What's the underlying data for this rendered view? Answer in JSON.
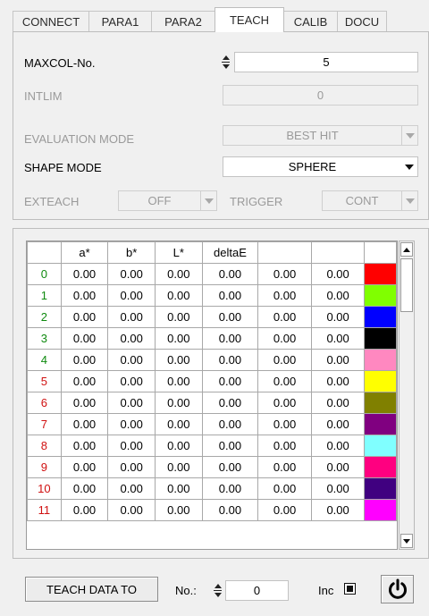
{
  "tabs": [
    "CONNECT",
    "PARA1",
    "PARA2",
    "TEACH",
    "CALIB",
    "DOCU"
  ],
  "active_tab": "TEACH",
  "settings": {
    "maxcol_label": "MAXCOL-No.",
    "maxcol_value": "5",
    "intlim_label": "INTLIM",
    "intlim_value": "0",
    "evaluation_label": "EVALUATION MODE",
    "evaluation_value": "BEST HIT",
    "shape_label": "SHAPE MODE",
    "shape_value": "SPHERE",
    "exteach_label": "EXTEACH",
    "exteach_value": "OFF",
    "trigger_label": "TRIGGER",
    "trigger_value": "CONT"
  },
  "table": {
    "headers": [
      "",
      "a*",
      "b*",
      "L*",
      "deltaE",
      "",
      "",
      ""
    ],
    "rows": [
      {
        "idx": "0",
        "idx_color": "#0f8a0f",
        "values": [
          "0.00",
          "0.00",
          "0.00",
          "0.00",
          "0.00",
          "0.00"
        ],
        "swatch": "#ff0000"
      },
      {
        "idx": "1",
        "idx_color": "#0f8a0f",
        "values": [
          "0.00",
          "0.00",
          "0.00",
          "0.00",
          "0.00",
          "0.00"
        ],
        "swatch": "#80ff00"
      },
      {
        "idx": "2",
        "idx_color": "#0f8a0f",
        "values": [
          "0.00",
          "0.00",
          "0.00",
          "0.00",
          "0.00",
          "0.00"
        ],
        "swatch": "#0000ff"
      },
      {
        "idx": "3",
        "idx_color": "#0f8a0f",
        "values": [
          "0.00",
          "0.00",
          "0.00",
          "0.00",
          "0.00",
          "0.00"
        ],
        "swatch": "#000000"
      },
      {
        "idx": "4",
        "idx_color": "#0f8a0f",
        "values": [
          "0.00",
          "0.00",
          "0.00",
          "0.00",
          "0.00",
          "0.00"
        ],
        "swatch": "#ff88c0"
      },
      {
        "idx": "5",
        "idx_color": "#d01010",
        "values": [
          "0.00",
          "0.00",
          "0.00",
          "0.00",
          "0.00",
          "0.00"
        ],
        "swatch": "#ffff00"
      },
      {
        "idx": "6",
        "idx_color": "#d01010",
        "values": [
          "0.00",
          "0.00",
          "0.00",
          "0.00",
          "0.00",
          "0.00"
        ],
        "swatch": "#808000"
      },
      {
        "idx": "7",
        "idx_color": "#d01010",
        "values": [
          "0.00",
          "0.00",
          "0.00",
          "0.00",
          "0.00",
          "0.00"
        ],
        "swatch": "#800080"
      },
      {
        "idx": "8",
        "idx_color": "#d01010",
        "values": [
          "0.00",
          "0.00",
          "0.00",
          "0.00",
          "0.00",
          "0.00"
        ],
        "swatch": "#80ffff"
      },
      {
        "idx": "9",
        "idx_color": "#d01010",
        "values": [
          "0.00",
          "0.00",
          "0.00",
          "0.00",
          "0.00",
          "0.00"
        ],
        "swatch": "#ff0080"
      },
      {
        "idx": "10",
        "idx_color": "#d01010",
        "values": [
          "0.00",
          "0.00",
          "0.00",
          "0.00",
          "0.00",
          "0.00"
        ],
        "swatch": "#400080"
      },
      {
        "idx": "11",
        "idx_color": "#d01010",
        "values": [
          "0.00",
          "0.00",
          "0.00",
          "0.00",
          "0.00",
          "0.00"
        ],
        "swatch": "#ff00ff"
      }
    ]
  },
  "bottom": {
    "teach_button": "TEACH DATA TO",
    "no_label": "No.:",
    "no_value": "0",
    "inc_label": "Inc",
    "inc_checked": true,
    "power_icon": "power-icon"
  }
}
